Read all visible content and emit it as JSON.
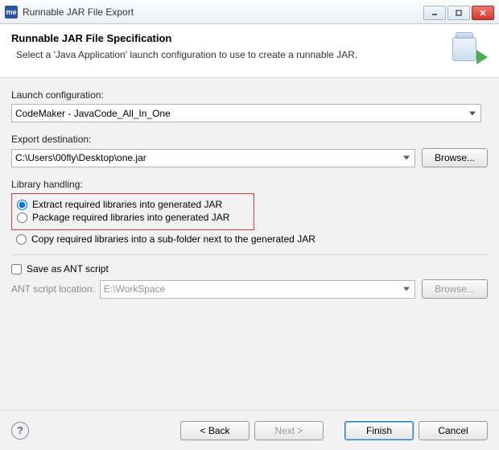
{
  "window": {
    "title": "Runnable JAR File Export",
    "app_icon_text": "me"
  },
  "banner": {
    "title": "Runnable JAR File Specification",
    "description": "Select a 'Java Application' launch configuration to use to create a runnable JAR."
  },
  "launch": {
    "label": "Launch configuration:",
    "value": "CodeMaker - JavaCode_All_In_One"
  },
  "export": {
    "label": "Export destination:",
    "value": "C:\\Users\\00fly\\Desktop\\one.jar",
    "browse": "Browse..."
  },
  "library": {
    "label": "Library handling:",
    "opt_extract": "Extract required libraries into generated JAR",
    "opt_package": "Package required libraries into generated JAR",
    "opt_copy": "Copy required libraries into a sub-folder next to the generated JAR"
  },
  "ant": {
    "save_label": "Save as ANT script",
    "location_label": "ANT script location:",
    "location_value": "E:\\WorkSpace",
    "browse": "Browse..."
  },
  "footer": {
    "back": "< Back",
    "next": "Next >",
    "finish": "Finish",
    "cancel": "Cancel",
    "help": "?"
  }
}
